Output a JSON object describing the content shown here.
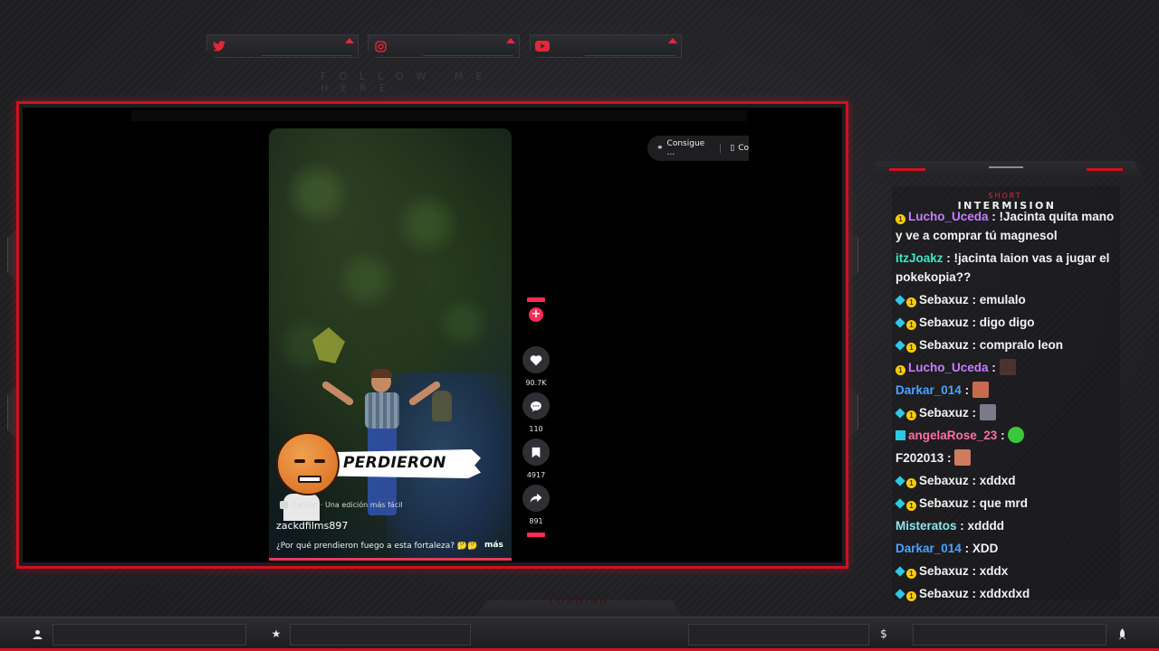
{
  "overlay": {
    "follow_text": "FOLLOW ME HERE",
    "social": [
      {
        "icon": "twitter-icon"
      },
      {
        "icon": "instagram-icon"
      },
      {
        "icon": "youtube-icon"
      }
    ],
    "accent_color": "#d3101e",
    "chat_title_small": "SHORT",
    "chat_title": "INTERMISION"
  },
  "video": {
    "overlay_word": "PERDIERON",
    "capcut_label": "CapCut · Una edición más fácil",
    "username": "zackdfilms897",
    "caption": "¿Por qué prendieron fuego a esta fortaleza? 🤔🤔 ...",
    "more_label": "más",
    "likes": "90.7K",
    "comments": "110",
    "saves": "4917",
    "shares": "891",
    "promo_label": "Consigue ...",
    "promo_label2": "Co"
  },
  "chat": {
    "messages": [
      {
        "badges": [
          "sub"
        ],
        "user": "Lucho_Uceda",
        "color": "#c77dff",
        "text": " : !Jacinta quita mano y ve a comprar tú magnesol"
      },
      {
        "badges": [],
        "user": "itzJoakz",
        "color": "#3ee6c6",
        "text": " : !jacinta laion vas a jugar el pokekopia??"
      },
      {
        "badges": [
          "gem",
          "sub"
        ],
        "user": "Sebaxuz",
        "color": "#f2f2f2",
        "text": " : emulalo"
      },
      {
        "badges": [
          "gem",
          "sub"
        ],
        "user": "Sebaxuz",
        "color": "#f2f2f2",
        "text": " : digo digo"
      },
      {
        "badges": [
          "gem",
          "sub"
        ],
        "user": "Sebaxuz",
        "color": "#f2f2f2",
        "text": " : compralo leon"
      },
      {
        "badges": [
          "sub"
        ],
        "user": "Lucho_Uceda",
        "color": "#c77dff",
        "text": " : ",
        "emote": "#4a3230"
      },
      {
        "badges": [],
        "user": "Darkar_014",
        "color": "#4aa3ff",
        "text": " : ",
        "emote": "#c86a50"
      },
      {
        "badges": [
          "gem",
          "sub"
        ],
        "user": "Sebaxuz",
        "color": "#f2f2f2",
        "text": " : ",
        "emote": "#7a7a8a"
      },
      {
        "badges": [
          "arrow"
        ],
        "user": "angelaRose_23",
        "color": "#ff6fa0",
        "text": " : ",
        "emote": "#39c93a"
      },
      {
        "badges": [],
        "user": "F202013",
        "color": "#f2f2f2",
        "text": " : ",
        "emote": "#d07a5e"
      },
      {
        "badges": [
          "gem",
          "sub"
        ],
        "user": "Sebaxuz",
        "color": "#f2f2f2",
        "text": " : xddxd"
      },
      {
        "badges": [
          "gem",
          "sub"
        ],
        "user": "Sebaxuz",
        "color": "#f2f2f2",
        "text": " : que mrd"
      },
      {
        "badges": [],
        "user": "Misteratos",
        "color": "#8ee6e6",
        "text": " : xdddd"
      },
      {
        "badges": [],
        "user": "Darkar_014",
        "color": "#4aa3ff",
        "text": " : XDD"
      },
      {
        "badges": [
          "gem",
          "sub"
        ],
        "user": "Sebaxuz",
        "color": "#f2f2f2",
        "text": " : xddx"
      },
      {
        "badges": [
          "gem",
          "sub"
        ],
        "user": "Sebaxuz",
        "color": "#f2f2f2",
        "text": " : xddxdxd"
      }
    ]
  },
  "bottom_bar": {
    "icons": [
      "user-icon",
      "star-icon",
      "dollar-icon",
      "rocket-icon"
    ],
    "loading_text": "LOADING"
  }
}
